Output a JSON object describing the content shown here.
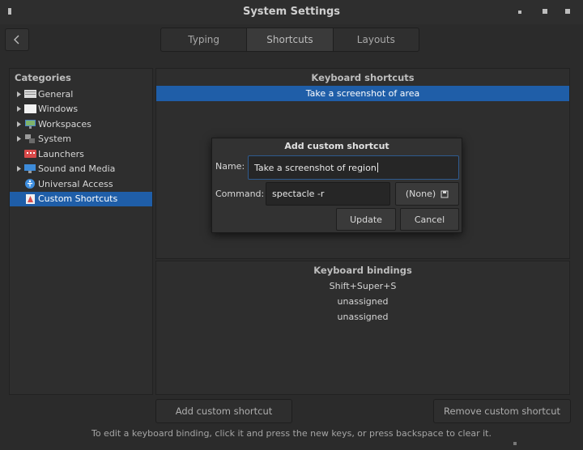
{
  "window": {
    "title": "System Settings"
  },
  "tabs": [
    {
      "label": "Typing",
      "active": false
    },
    {
      "label": "Shortcuts",
      "active": true
    },
    {
      "label": "Layouts",
      "active": false
    }
  ],
  "sidebar": {
    "header": "Categories",
    "items": [
      {
        "label": "General",
        "icon": "general-icon",
        "expandable": true
      },
      {
        "label": "Windows",
        "icon": "windows-icon",
        "expandable": true
      },
      {
        "label": "Workspaces",
        "icon": "workspaces-icon",
        "expandable": true
      },
      {
        "label": "System",
        "icon": "system-icon",
        "expandable": true
      },
      {
        "label": "Launchers",
        "icon": "launchers-icon",
        "expandable": false
      },
      {
        "label": "Sound and Media",
        "icon": "sound-media-icon",
        "expandable": true
      },
      {
        "label": "Universal Access",
        "icon": "universal-access-icon",
        "expandable": false
      },
      {
        "label": "Custom Shortcuts",
        "icon": "custom-shortcuts-icon",
        "expandable": false,
        "selected": true
      }
    ]
  },
  "shortcuts_panel": {
    "header": "Keyboard shortcuts",
    "rows": [
      "Take a screenshot of area"
    ]
  },
  "bindings_panel": {
    "header": "Keyboard bindings",
    "rows": [
      "Shift+Super+S",
      "unassigned",
      "unassigned"
    ]
  },
  "dialog": {
    "title": "Add custom shortcut",
    "name_label": "Name:",
    "name_value": "Take a screenshot of region",
    "command_label": "Command:",
    "command_value": "spectacle -r",
    "none_button": "(None)",
    "update_button": "Update",
    "cancel_button": "Cancel"
  },
  "buttons": {
    "add": "Add custom shortcut",
    "remove": "Remove custom shortcut"
  },
  "hint": "To edit a keyboard binding, click it and press the new keys, or press backspace to clear it.",
  "colors": {
    "accent": "#1f5ea8",
    "background": "#2b2b2b"
  }
}
